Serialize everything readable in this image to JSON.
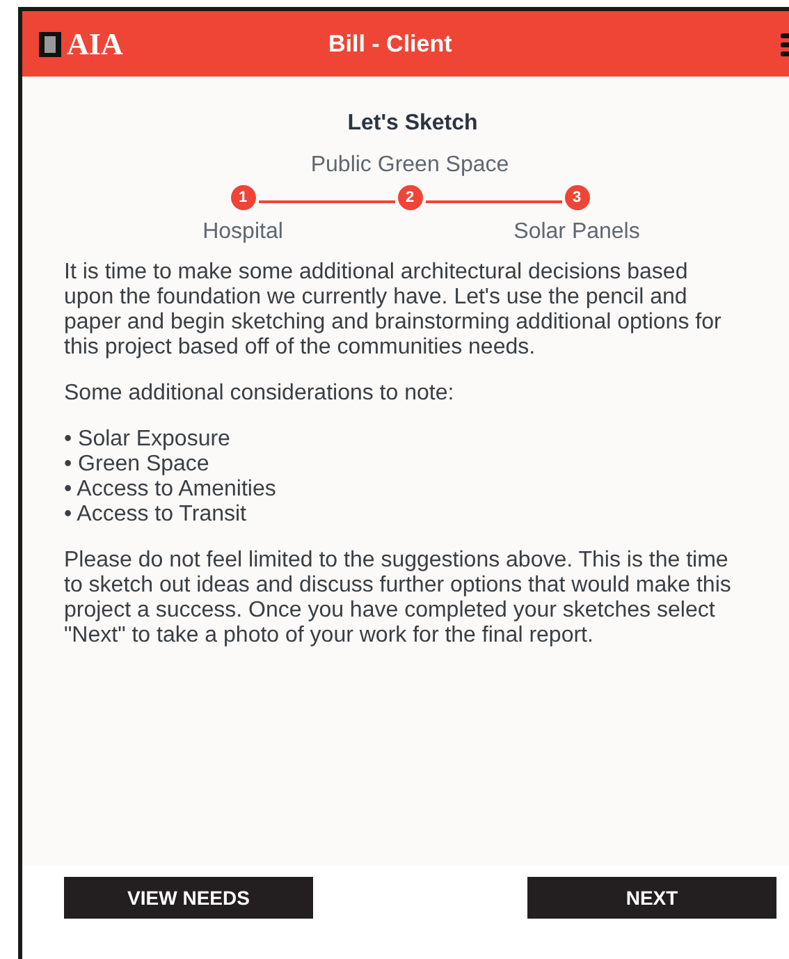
{
  "header": {
    "logo": "AIA",
    "title": "Bill - Client"
  },
  "heading": "Let's Sketch",
  "steps": [
    {
      "number": "1",
      "label": "Hospital",
      "kind": "below"
    },
    {
      "number": "2",
      "label": "Public Green Space",
      "kind": "above"
    },
    {
      "number": "3",
      "label": "Solar Panels",
      "kind": "below"
    }
  ],
  "intro": "It is time to make some additional architectural decisions based upon the foundation we currently have. Let's use the pencil and paper and begin sketching and brainstorming additional options for this project based off of the communities needs.",
  "considerations_title": "Some additional considerations to note:",
  "considerations": [
    "• Solar Exposure",
    "• Green Space",
    "• Access to Amenities",
    "• Access to Transit"
  ],
  "closing": "Please do not feel limited to the suggestions above. This is the time to sketch out ideas and discuss further options that would make this project a success. Once you have completed your sketches select \"Next\" to take a photo of your work for the final report.",
  "buttons": [
    "VIEW NEEDS",
    "NEXT"
  ]
}
